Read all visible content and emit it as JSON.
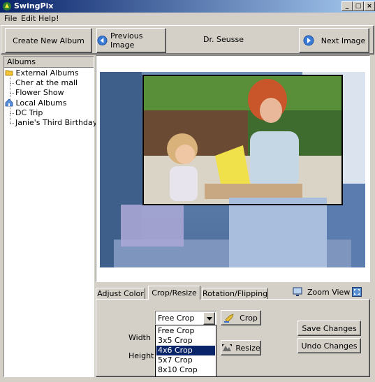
{
  "app": {
    "title": "SwingPix"
  },
  "menu": {
    "file": "File",
    "edit": "Edit",
    "help": "Help!"
  },
  "toolbar": {
    "create_album": "Create New Album",
    "previous_image": "Previous Image",
    "album_name": "Dr. Seusse",
    "next_image": "Next Image"
  },
  "tree": {
    "header": "Albums",
    "external": "External Albums",
    "external_items": [
      "Cher at the mall",
      "Flower Show"
    ],
    "local": "Local Albums",
    "local_items": [
      "DC Trip",
      "Janie's Third Birthday"
    ]
  },
  "tabs": {
    "adjust": "Adjust Color",
    "crop": "Crop/Resize",
    "rotation": "Rotation/Flipping"
  },
  "zoom": {
    "label": "Zoom View"
  },
  "crop": {
    "selected": "Free Crop",
    "options": [
      "Free Crop",
      "3x5 Crop",
      "4x6 Crop",
      "5x7 Crop",
      "8x10 Crop"
    ],
    "highlighted_index": 2,
    "width_label": "Width",
    "height_label": "Height",
    "crop_button": "Crop",
    "resize_button": "Resize",
    "save_changes": "Save Changes",
    "undo_changes": "Undo Changes"
  },
  "colors": {
    "titlebar_start": "#0a246a",
    "titlebar_end": "#a6caf0",
    "selection": "#0a246a",
    "window_bg": "#d4d0c8"
  }
}
